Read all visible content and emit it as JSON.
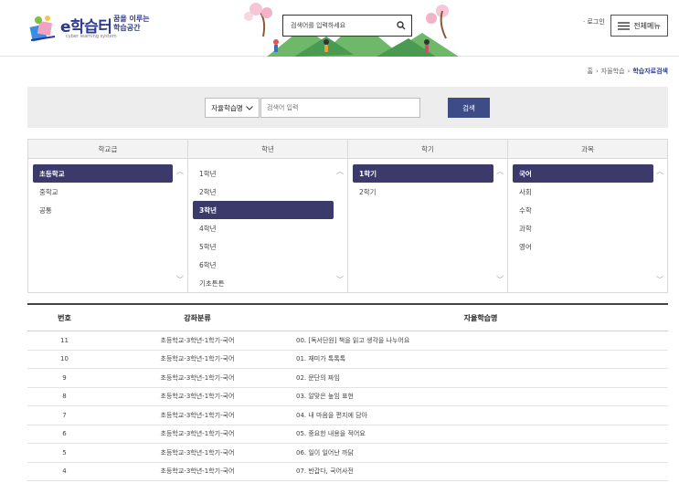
{
  "header": {
    "logo_title": "e학습터",
    "logo_sub": "cyber learning system",
    "logo_slogan": "꿈을 이루는 학습공간",
    "search_placeholder": "검색어를 입력하세요",
    "login_label": "· 로그인",
    "menu_label": "전체메뉴"
  },
  "breadcrumb": {
    "items": [
      "홈",
      "자율학습",
      "학습자료검색"
    ]
  },
  "search_panel": {
    "select_value": "자율학습명",
    "keyword_placeholder": "검색어 입력",
    "search_button": "검색"
  },
  "filters": {
    "columns": [
      {
        "header": "학교급",
        "items": [
          "초등학교",
          "중학교",
          "공통"
        ],
        "selected": 0
      },
      {
        "header": "학년",
        "items": [
          "1학년",
          "2학년",
          "3학년",
          "4학년",
          "5학년",
          "6학년",
          "기초튼튼"
        ],
        "selected": 2
      },
      {
        "header": "학기",
        "items": [
          "1학기",
          "2학기"
        ],
        "selected": 0
      },
      {
        "header": "과목",
        "items": [
          "국어",
          "사회",
          "수학",
          "과학",
          "영어"
        ],
        "selected": 0
      }
    ]
  },
  "table": {
    "headers": {
      "no": "번호",
      "category": "강좌분류",
      "title": "자율학습명"
    },
    "rows": [
      {
        "no": "11",
        "category": "초등학교-3학년-1학기-국어",
        "title": "00. [독서단원] 책을 읽고 생각을 나누어요"
      },
      {
        "no": "10",
        "category": "초등학교-3학년-1학기-국어",
        "title": "01. 재미가 톡톡톡"
      },
      {
        "no": "9",
        "category": "초등학교-3학년-1학기-국어",
        "title": "02. 문단의 짜임"
      },
      {
        "no": "8",
        "category": "초등학교-3학년-1학기-국어",
        "title": "03. 알맞은 높임 표현"
      },
      {
        "no": "7",
        "category": "초등학교-3학년-1학기-국어",
        "title": "04. 내 마음을 편지에 담아"
      },
      {
        "no": "6",
        "category": "초등학교-3학년-1학기-국어",
        "title": "05. 중요한 내용을 적어요"
      },
      {
        "no": "5",
        "category": "초등학교-3학년-1학기-국어",
        "title": "06. 일이 일어난 까닭"
      },
      {
        "no": "4",
        "category": "초등학교-3학년-1학기-국어",
        "title": "07. 반갑다, 국어사전"
      }
    ]
  },
  "colors": {
    "brand": "#2b3a8f",
    "button": "#3d4c86",
    "selected_item": "#3b3a6b",
    "panel_bg": "#ededed"
  }
}
